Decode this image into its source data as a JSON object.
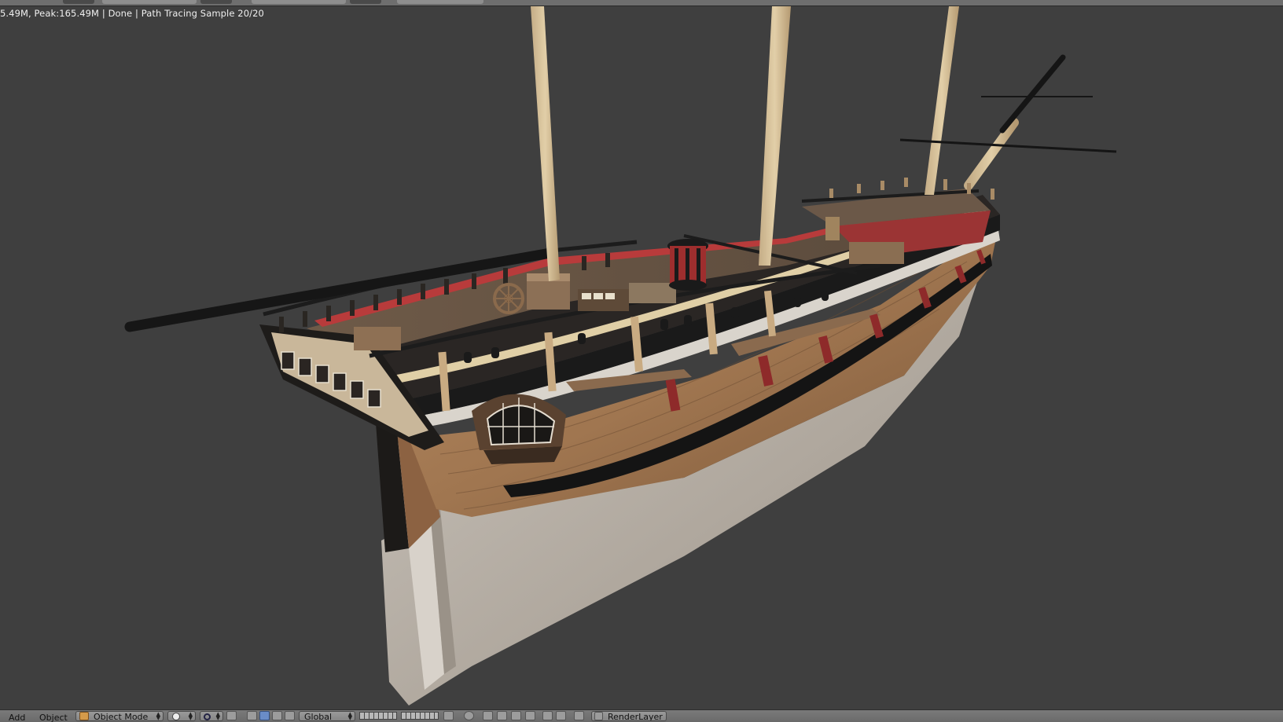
{
  "status_bar": {
    "text": "5.49M, Peak:165.49M | Done | Path Tracing Sample 20/20"
  },
  "header": {
    "menu_add": "Add",
    "menu_object": "Object",
    "mode_label": "Object Mode",
    "orientation_label": "Global",
    "render_layer_label": "RenderLayer"
  },
  "icons": {
    "mode": "cube-icon",
    "shading": "sphere-icon",
    "pivot": "pivot-icon",
    "manipulator": "transform-manipulator-icon",
    "layers": "layers-grid-icon",
    "snap": "magnet-icon",
    "proportional": "proportional-edit-icon",
    "render_layer": "render-layer-icon"
  },
  "colors": {
    "viewport_bg": "#3f3f3f",
    "header_bg": "#727272",
    "accent_blue": "#6a8cc8"
  }
}
